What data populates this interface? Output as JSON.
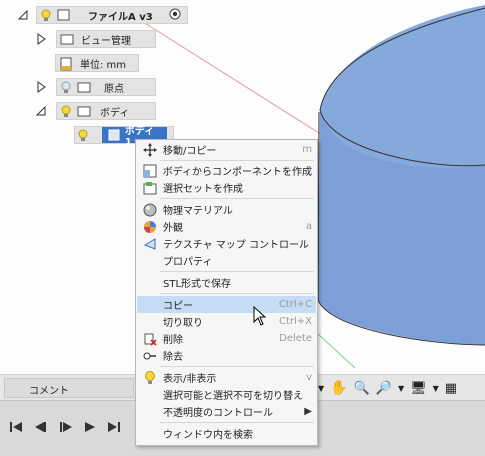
{
  "browser": {
    "root": {
      "label": "ファイルA v3"
    },
    "items": [
      {
        "label": "ビュー管理"
      },
      {
        "label": "単位: mm"
      },
      {
        "label": "原点"
      },
      {
        "label": "ボディ"
      },
      {
        "label": "ボディ1"
      }
    ]
  },
  "comment_label": "コメント",
  "context_menu": {
    "items": [
      {
        "label": "移動/コピー",
        "shortcut": "m",
        "icon": "move-icon"
      },
      {
        "label": "ボディからコンポーネントを作成",
        "shortcut": "",
        "icon": "component-icon"
      },
      {
        "label": "選択セットを作成",
        "shortcut": "",
        "icon": "selection-set-icon"
      },
      {
        "label": "物理マテリアル",
        "shortcut": "",
        "icon": "material-icon"
      },
      {
        "label": "外観",
        "shortcut": "a",
        "icon": "appearance-icon"
      },
      {
        "label": "テクスチャ マップ コントロール",
        "shortcut": "",
        "icon": "texture-map-icon"
      },
      {
        "label": "プロパティ",
        "shortcut": "",
        "icon": ""
      },
      {
        "label": "STL形式で保存",
        "shortcut": "",
        "icon": ""
      },
      {
        "label": "コピー",
        "shortcut": "Ctrl+C",
        "icon": "",
        "highlighted": true
      },
      {
        "label": "切り取り",
        "shortcut": "Ctrl+X",
        "icon": ""
      },
      {
        "label": "削除",
        "shortcut": "Delete",
        "icon": "delete-icon"
      },
      {
        "label": "除去",
        "shortcut": "",
        "icon": "remove-icon"
      },
      {
        "label": "表示/非表示",
        "shortcut": "v",
        "icon": "lightbulb-icon"
      },
      {
        "label": "選択可能と選択不可を切り替え",
        "shortcut": "",
        "icon": ""
      },
      {
        "label": "不透明度のコントロール",
        "shortcut": "▶",
        "icon": ""
      },
      {
        "label": "ウィンドウ内を検索",
        "shortcut": "",
        "icon": ""
      }
    ]
  },
  "colors": {
    "body_blue": "#7b9fd6",
    "highlight": "#c6dcf5",
    "selected_node": "#3b74c6"
  }
}
